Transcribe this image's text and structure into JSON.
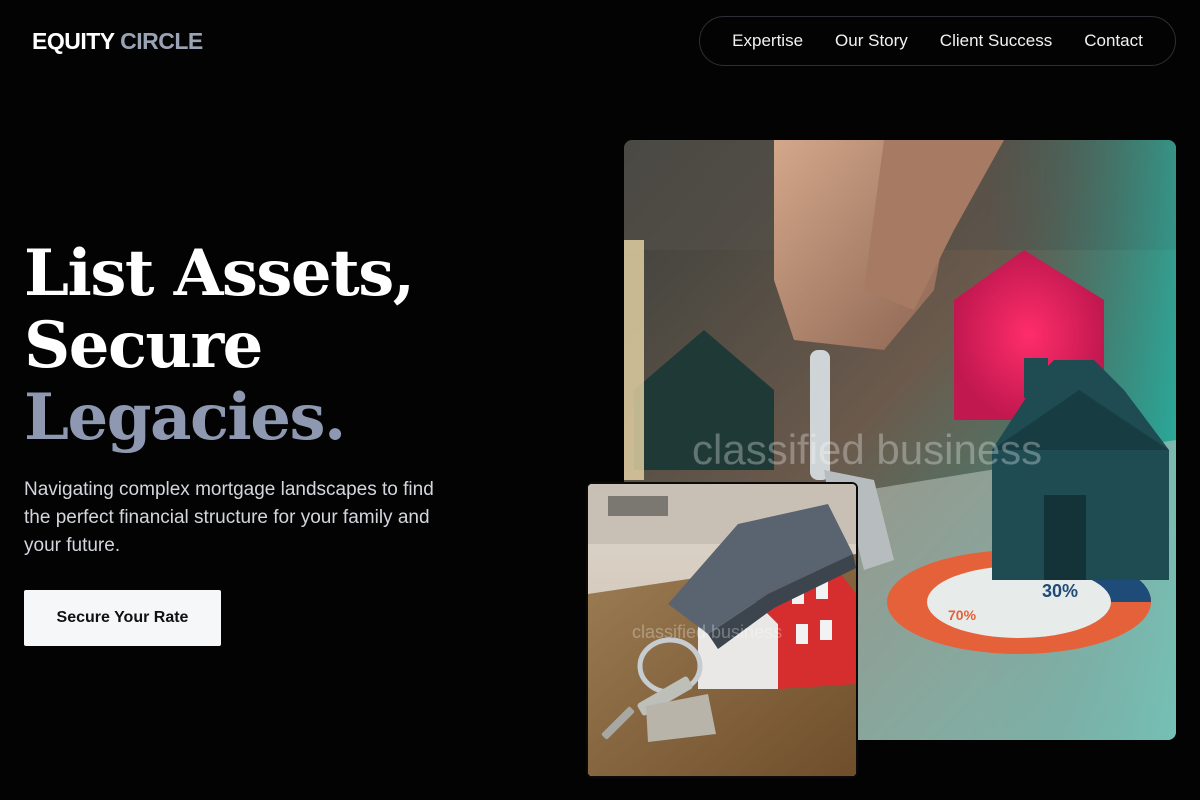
{
  "brand": {
    "name_primary": "EQUITY",
    "name_secondary": "CIRCLE"
  },
  "nav": {
    "items": [
      {
        "label": "Expertise"
      },
      {
        "label": "Our Story"
      },
      {
        "label": "Client Success"
      },
      {
        "label": "Contact"
      }
    ]
  },
  "hero": {
    "headline_line1": "List Assets,",
    "headline_line2": "Secure",
    "headline_line3": "Legacies.",
    "lead": "Navigating complex mortgage landscapes to find the perfect financial structure for your family and your future.",
    "cta_label": "Secure Your Rate"
  },
  "images": {
    "main_watermark": "classified business",
    "small_watermark": "classified business",
    "chart_label_large": "30%",
    "chart_label_small": "70%"
  },
  "colors": {
    "background": "#030303",
    "accent_text": "#8e98b0",
    "cta_background": "#f6f7f9"
  }
}
